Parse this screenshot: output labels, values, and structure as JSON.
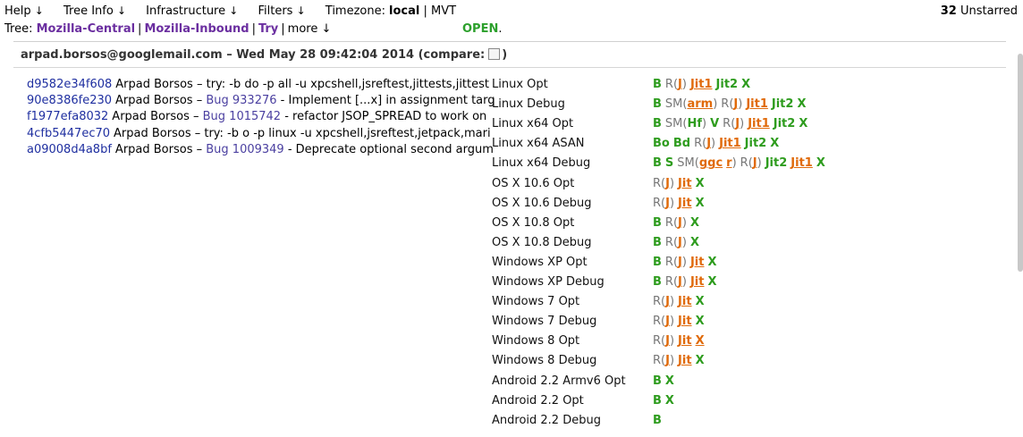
{
  "topbar": {
    "menus": [
      "Help",
      "Tree Info",
      "Filters"
    ],
    "infra": "Infrastructure",
    "timezone_label": "Timezone:",
    "timezone_local": "local",
    "timezone_other": "MVT",
    "unstarred_count": "32",
    "unstarred_label": "Unstarred"
  },
  "treebar": {
    "label": "Tree:",
    "trees": [
      "Mozilla-Central",
      "Mozilla-Inbound",
      "Try"
    ],
    "more": "more",
    "status": "OPEN",
    "status_suffix": "."
  },
  "push": {
    "author": "arpad.borsos@googlemail.com",
    "dash": "–",
    "date": "Wed May 28 09:42:04 2014",
    "compare": "(compare:",
    "compare_close": ")"
  },
  "revisions": [
    {
      "hash": "d9582e34f608",
      "author": "Arpad Borsos",
      "sep": "–",
      "bug": "",
      "message": "try: -b do -p all -u xpcshell,jsreftest,jittests,jittest"
    },
    {
      "hash": "90e8386fe230",
      "author": "Arpad Borsos",
      "sep": "–",
      "bug": "Bug 933276",
      "message": "- Implement [...x] in assignment targ"
    },
    {
      "hash": "f1977efa8032",
      "author": "Arpad Borsos",
      "sep": "–",
      "bug": "Bug 1015742",
      "message": "- refactor JSOP_SPREAD to work on"
    },
    {
      "hash": "4cfb5447ec70",
      "author": "Arpad Borsos",
      "sep": "–",
      "bug": "",
      "message": "try: -b o -p linux -u xpcshell,jsreftest,jetpack,mari"
    },
    {
      "hash": "a09008d4a8bf",
      "author": "Arpad Borsos",
      "sep": "–",
      "bug": "Bug 1009349",
      "message": "- Deprecate optional second argum"
    }
  ],
  "platforms": [
    {
      "name": "Linux Opt",
      "jobs": [
        [
          "B",
          "g"
        ],
        [
          "R",
          "grey"
        ],
        [
          "(",
          "grp"
        ],
        [
          "J",
          "o"
        ],
        [
          ")",
          "grp"
        ],
        [
          "Jit1",
          "o"
        ],
        [
          "Jit2",
          "g"
        ],
        [
          "X",
          "g"
        ]
      ]
    },
    {
      "name": "Linux Debug",
      "jobs": [
        [
          "B",
          "g"
        ],
        [
          "SM",
          "grey"
        ],
        [
          "(",
          "grp"
        ],
        [
          "arm",
          "o"
        ],
        [
          ")",
          "grp"
        ],
        [
          "R",
          "grey"
        ],
        [
          "(",
          "grp"
        ],
        [
          "J",
          "o"
        ],
        [
          ")",
          "grp"
        ],
        [
          "Jit1",
          "o"
        ],
        [
          "Jit2",
          "g"
        ],
        [
          "X",
          "g"
        ]
      ]
    },
    {
      "name": "Linux x64 Opt",
      "jobs": [
        [
          "B",
          "g"
        ],
        [
          "SM",
          "grey"
        ],
        [
          "(",
          "grp"
        ],
        [
          "Hf",
          "g"
        ],
        [
          ")",
          "grp"
        ],
        [
          "V",
          "g"
        ],
        [
          "R",
          "grey"
        ],
        [
          "(",
          "grp"
        ],
        [
          "J",
          "o"
        ],
        [
          ")",
          "grp"
        ],
        [
          "Jit1",
          "o"
        ],
        [
          "Jit2",
          "g"
        ],
        [
          "X",
          "g"
        ]
      ]
    },
    {
      "name": "Linux x64 ASAN",
      "jobs": [
        [
          "Bo",
          "g"
        ],
        [
          "Bd",
          "g"
        ],
        [
          "R",
          "grey"
        ],
        [
          "(",
          "grp"
        ],
        [
          "J",
          "o"
        ],
        [
          ")",
          "grp"
        ],
        [
          "Jit1",
          "o"
        ],
        [
          "Jit2",
          "g"
        ],
        [
          "X",
          "g"
        ]
      ]
    },
    {
      "name": "Linux x64 Debug",
      "jobs": [
        [
          "B",
          "g"
        ],
        [
          "S",
          "g"
        ],
        [
          "SM",
          "grey"
        ],
        [
          "(",
          "grp"
        ],
        [
          "ggc",
          "o"
        ],
        [
          "r",
          "o"
        ],
        [
          ")",
          "grp"
        ],
        [
          "R",
          "grey"
        ],
        [
          "(",
          "grp"
        ],
        [
          "J",
          "o"
        ],
        [
          ")",
          "grp"
        ],
        [
          "Jit2",
          "g"
        ],
        [
          "Jit1",
          "o"
        ],
        [
          "X",
          "g"
        ]
      ]
    },
    {
      "name": "OS X 10.6 Opt",
      "jobs": [
        [
          "R",
          "grey"
        ],
        [
          "(",
          "grp"
        ],
        [
          "J",
          "o"
        ],
        [
          ")",
          "grp"
        ],
        [
          "Jit",
          "o"
        ],
        [
          "X",
          "g"
        ]
      ]
    },
    {
      "name": "OS X 10.6 Debug",
      "jobs": [
        [
          "R",
          "grey"
        ],
        [
          "(",
          "grp"
        ],
        [
          "J",
          "o"
        ],
        [
          ")",
          "grp"
        ],
        [
          "Jit",
          "o"
        ],
        [
          "X",
          "g"
        ]
      ]
    },
    {
      "name": "OS X 10.8 Opt",
      "jobs": [
        [
          "B",
          "g"
        ],
        [
          "R",
          "grey"
        ],
        [
          "(",
          "grp"
        ],
        [
          "J",
          "o"
        ],
        [
          ")",
          "grp"
        ],
        [
          "X",
          "g"
        ]
      ]
    },
    {
      "name": "OS X 10.8 Debug",
      "jobs": [
        [
          "B",
          "g"
        ],
        [
          "R",
          "grey"
        ],
        [
          "(",
          "grp"
        ],
        [
          "J",
          "o"
        ],
        [
          ")",
          "grp"
        ],
        [
          "X",
          "g"
        ]
      ]
    },
    {
      "name": "Windows XP Opt",
      "jobs": [
        [
          "B",
          "g"
        ],
        [
          "R",
          "grey"
        ],
        [
          "(",
          "grp"
        ],
        [
          "J",
          "o"
        ],
        [
          ")",
          "grp"
        ],
        [
          "Jit",
          "o"
        ],
        [
          "X",
          "g"
        ]
      ]
    },
    {
      "name": "Windows XP Debug",
      "jobs": [
        [
          "B",
          "g"
        ],
        [
          "R",
          "grey"
        ],
        [
          "(",
          "grp"
        ],
        [
          "J",
          "o"
        ],
        [
          ")",
          "grp"
        ],
        [
          "Jit",
          "o"
        ],
        [
          "X",
          "g"
        ]
      ]
    },
    {
      "name": "Windows 7 Opt",
      "jobs": [
        [
          "R",
          "grey"
        ],
        [
          "(",
          "grp"
        ],
        [
          "J",
          "o"
        ],
        [
          ")",
          "grp"
        ],
        [
          "Jit",
          "o"
        ],
        [
          "X",
          "g"
        ]
      ]
    },
    {
      "name": "Windows 7 Debug",
      "jobs": [
        [
          "R",
          "grey"
        ],
        [
          "(",
          "grp"
        ],
        [
          "J",
          "o"
        ],
        [
          ")",
          "grp"
        ],
        [
          "Jit",
          "o"
        ],
        [
          "X",
          "g"
        ]
      ]
    },
    {
      "name": "Windows 8 Opt",
      "jobs": [
        [
          "R",
          "grey"
        ],
        [
          "(",
          "grp"
        ],
        [
          "J",
          "o"
        ],
        [
          ")",
          "grp"
        ],
        [
          "Jit",
          "o"
        ],
        [
          "X",
          "o"
        ]
      ]
    },
    {
      "name": "Windows 8 Debug",
      "jobs": [
        [
          "R",
          "grey"
        ],
        [
          "(",
          "grp"
        ],
        [
          "J",
          "o"
        ],
        [
          ")",
          "grp"
        ],
        [
          "Jit",
          "o"
        ],
        [
          "X",
          "g"
        ]
      ]
    },
    {
      "name": "Android 2.2 Armv6 Opt",
      "jobs": [
        [
          "B",
          "g"
        ],
        [
          "X",
          "g"
        ]
      ]
    },
    {
      "name": "Android 2.2 Opt",
      "jobs": [
        [
          "B",
          "g"
        ],
        [
          "X",
          "g"
        ]
      ]
    },
    {
      "name": "Android 2.2 Debug",
      "jobs": [
        [
          "B",
          "g"
        ]
      ]
    }
  ],
  "colors": {
    "success": "#2e9c1e",
    "warning": "#e06a0a",
    "tree_link": "#6b2fa0",
    "hash": "#1f2fa0"
  },
  "icons": {
    "menu_arrow": "down-arrow-icon"
  }
}
